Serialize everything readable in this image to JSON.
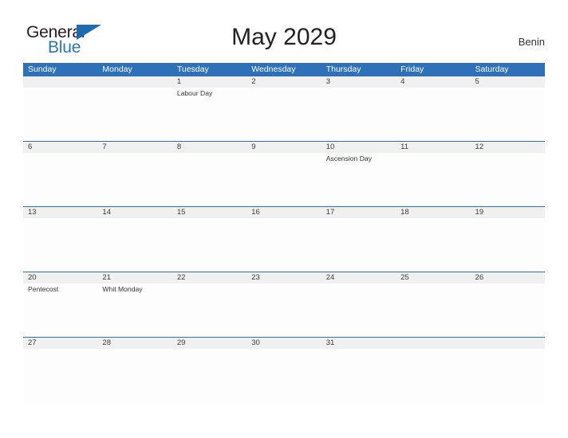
{
  "brand": {
    "name_part1": "General",
    "name_part2": "Blue",
    "triangle_icon": "triangle-icon",
    "color_dark": "#231f20",
    "color_blue": "#2b74b8"
  },
  "header": {
    "title": "May 2029",
    "country": "Benin"
  },
  "theme": {
    "accent": "#2e71b8",
    "date_band": "#f0f0f0",
    "cell_bg": "#fdfdfd",
    "header_text": "#ffffff"
  },
  "calendar": {
    "month": "May",
    "year": "2029",
    "weekday_headers": [
      "Sunday",
      "Monday",
      "Tuesday",
      "Wednesday",
      "Thursday",
      "Friday",
      "Saturday"
    ],
    "weeks": [
      {
        "days": [
          {
            "date": "",
            "events": []
          },
          {
            "date": "",
            "events": []
          },
          {
            "date": "1",
            "events": [
              "Labour Day"
            ]
          },
          {
            "date": "2",
            "events": []
          },
          {
            "date": "3",
            "events": []
          },
          {
            "date": "4",
            "events": []
          },
          {
            "date": "5",
            "events": []
          }
        ]
      },
      {
        "days": [
          {
            "date": "6",
            "events": []
          },
          {
            "date": "7",
            "events": []
          },
          {
            "date": "8",
            "events": []
          },
          {
            "date": "9",
            "events": []
          },
          {
            "date": "10",
            "events": [
              "Ascension Day"
            ]
          },
          {
            "date": "11",
            "events": []
          },
          {
            "date": "12",
            "events": []
          }
        ]
      },
      {
        "days": [
          {
            "date": "13",
            "events": []
          },
          {
            "date": "14",
            "events": []
          },
          {
            "date": "15",
            "events": []
          },
          {
            "date": "16",
            "events": []
          },
          {
            "date": "17",
            "events": []
          },
          {
            "date": "18",
            "events": []
          },
          {
            "date": "19",
            "events": []
          }
        ]
      },
      {
        "days": [
          {
            "date": "20",
            "events": [
              "Pentecost"
            ]
          },
          {
            "date": "21",
            "events": [
              "Whit Monday"
            ]
          },
          {
            "date": "22",
            "events": []
          },
          {
            "date": "23",
            "events": []
          },
          {
            "date": "24",
            "events": []
          },
          {
            "date": "25",
            "events": []
          },
          {
            "date": "26",
            "events": []
          }
        ]
      },
      {
        "days": [
          {
            "date": "27",
            "events": []
          },
          {
            "date": "28",
            "events": []
          },
          {
            "date": "29",
            "events": []
          },
          {
            "date": "30",
            "events": []
          },
          {
            "date": "31",
            "events": []
          },
          {
            "date": "",
            "events": []
          },
          {
            "date": "",
            "events": []
          }
        ]
      }
    ]
  }
}
